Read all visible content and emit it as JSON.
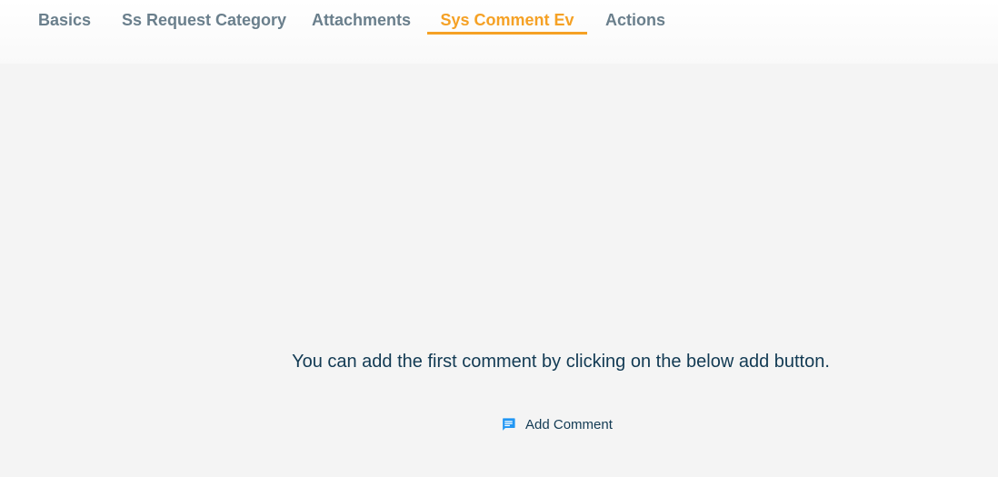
{
  "tabs": [
    {
      "label": "Basics"
    },
    {
      "label": "Ss Request Category"
    },
    {
      "label": "Attachments"
    },
    {
      "label": "Sys Comment Ev",
      "active": true
    },
    {
      "label": "Actions"
    }
  ],
  "comments": {
    "empty_message": "You can add the first comment by clicking on the below add button.",
    "add_button_label": "Add Comment",
    "add_button_icon": "comment-icon"
  },
  "colors": {
    "active_tab": "#f5a125",
    "inactive_tab": "#6a7f8c",
    "text": "#123a53",
    "icon": "#2196f3"
  }
}
